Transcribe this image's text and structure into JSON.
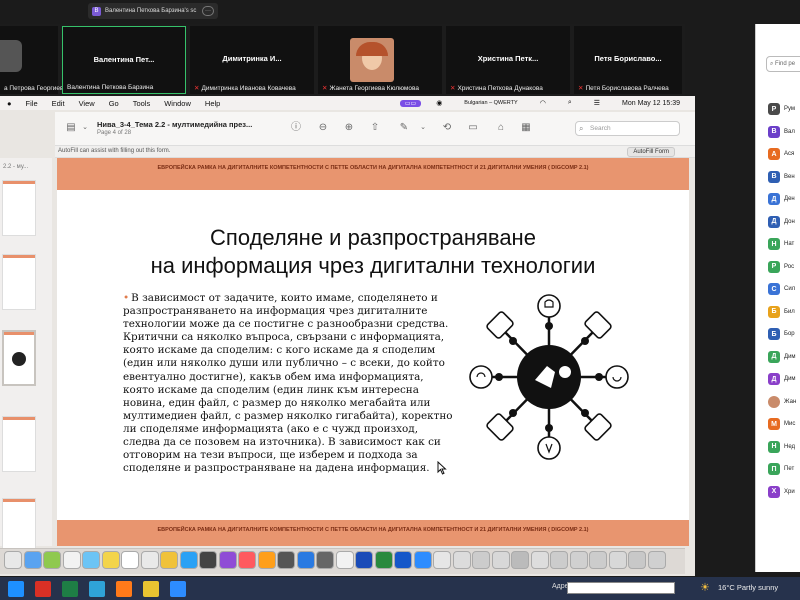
{
  "share_pill": {
    "initial": "В",
    "label": "Валентина Петкова Барзина's sc"
  },
  "participants": [
    {
      "name": "",
      "caption": "а Петрова Георгиева"
    },
    {
      "name": "Валентина Пет...",
      "caption": "Валентина Петкова Барзина"
    },
    {
      "name": "Димитринка И...",
      "caption": "Димитринка Иванова Ковачева"
    },
    {
      "name": "",
      "caption": "Жанета Георгиева Кюлюмова"
    },
    {
      "name": "Христина Петк...",
      "caption": "Христина Петкова Дунакова"
    },
    {
      "name": "Петя Бориславо...",
      "caption": "Петя Бориславова Ралчева"
    }
  ],
  "people_panel": {
    "find_placeholder": "Find pe",
    "people": [
      {
        "initial": "Р",
        "label": "Рум",
        "color": "#4a4a4a"
      },
      {
        "initial": "В",
        "label": "Вал",
        "color": "#6b3fc9"
      },
      {
        "initial": "А",
        "label": "Ася",
        "color": "#e76b21"
      },
      {
        "initial": "В",
        "label": "Вен",
        "color": "#2f5fb3"
      },
      {
        "initial": "Д",
        "label": "Ден",
        "color": "#3a73d6"
      },
      {
        "initial": "Д",
        "label": "Дон",
        "color": "#2f5fb3"
      },
      {
        "initial": "Н",
        "label": "Нат",
        "color": "#3aa55a"
      },
      {
        "initial": "Р",
        "label": "Рос",
        "color": "#3aa55a"
      },
      {
        "initial": "С",
        "label": "Сил",
        "color": "#3a73d6"
      },
      {
        "initial": "Б",
        "label": "Бил",
        "color": "#e8a21c"
      },
      {
        "initial": "Б",
        "label": "Бор",
        "color": "#2f5fb3"
      },
      {
        "initial": "Д",
        "label": "Дим",
        "color": "#3aa55a"
      },
      {
        "initial": "Д",
        "label": "Дим",
        "color": "#8a3fc9"
      },
      {
        "initial": "",
        "label": "Жан",
        "color": "#c98b6a"
      },
      {
        "initial": "М",
        "label": "Мис",
        "color": "#e76b21"
      },
      {
        "initial": "Н",
        "label": "Нед",
        "color": "#3aa55a"
      },
      {
        "initial": "П",
        "label": "Пет",
        "color": "#3aa55a"
      },
      {
        "initial": "Х",
        "label": "Хри",
        "color": "#8a3fc9"
      }
    ]
  },
  "menubar": {
    "items": [
      "File",
      "Edit",
      "View",
      "Go",
      "Tools",
      "Window",
      "Help"
    ],
    "keyboard": "Bulgarian – QWERTY",
    "datetime": "Mon May 12  15:39"
  },
  "preview": {
    "title": "Нива_3-4_Тема 2.2 - мултимедийна през...",
    "page": "Page 4 of 28",
    "search_placeholder": "Search",
    "autofill_text": "AutoFill can assist with filling out this form.",
    "autofill_button": "AutoFill Form",
    "sidebar_label": "2.2 - му..."
  },
  "slide": {
    "header": "ЕВРОПЕЙСКА РАМКА НА ДИГИТАЛНИТЕ КОМПЕТЕНТНОСТИ С ПЕТТЕ ОБЛАСТИ НА ДИГИТАЛНА КОМПЕТЕНТНОСТ И 21 ДИГИТАЛНИ УМЕНИЯ ( DIGCOMP 2.1)",
    "footer": "ЕВРОПЕЙСКА РАМКА НА ДИГИТАЛНИТЕ КОМПЕТЕНТНОСТИ С ПЕТТЕ ОБЛАСТИ НА ДИГИТАЛНА КОМПЕТЕНТНОСТ И 21 ДИГИТАЛНИ УМЕНИЯ ( DIGCOMP 2.1)",
    "title_line1": "Споделяне и разпространяване",
    "title_line2": "на информация чрез дигитални технологии",
    "body": "В зависимост от задачите, които имаме, споделянето и разпространяването на информация чрез дигиталните технологии може да се постигне с разнообразни средства. Критични са няколко въпроса, свързани с информацията, която искаме да споделим: с кого искаме да я споделим (един или няколко души или публично – с всеки, до който евентуално достигне), какъв обем има информацията, която искаме да споделим (един линк към интересна новина, един файл, с размер до няколко мегабайта или мултимедиен файл, с размер няколко гигабайта), коректно ли споделяме информацията (ако е с чужд произход, следва да се позовем на източника). В зависимост как си отговорим на тези въпроси, ще изберем и подхода за споделяне и разпространяване на дадена информация."
  },
  "taskbar": {
    "address_label": "Адрес",
    "weather": "16°C  Partly sunny"
  }
}
